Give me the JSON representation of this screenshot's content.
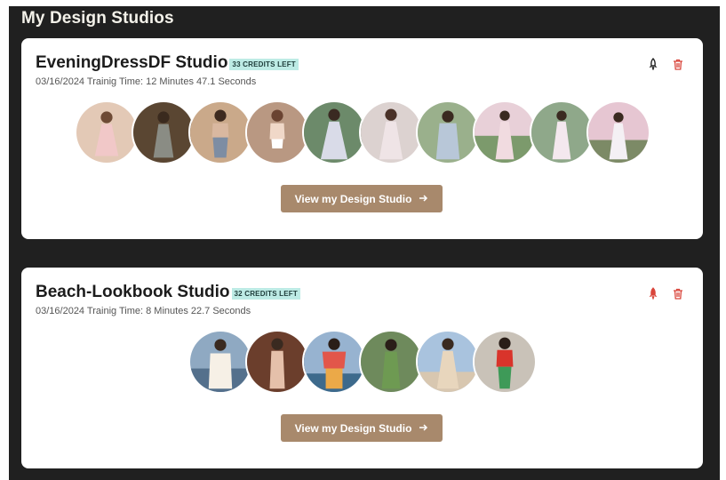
{
  "page_title": "My Design Studios",
  "colors": {
    "background": "#202020",
    "card": "#ffffff",
    "credits_badge": "#bdebe5",
    "button": "#a8896c",
    "delete_icon": "#d9453b",
    "status_icon_active": "#d9453b",
    "status_icon_inactive": "#222222"
  },
  "studios": [
    {
      "name": "EveningDressDF Studio",
      "credits": "33 CREDITS LEFT",
      "meta": "03/16/2024 Trainig Time: 12 Minutes 47.1 Seconds",
      "status_icon": "rocket-icon",
      "delete_icon": "trash-icon",
      "button_label": "View my Design Studio",
      "button_icon": "arrow-right-icon",
      "avatar_count": 10
    },
    {
      "name": "Beach-Lookbook Studio",
      "credits": "32 CREDITS LEFT",
      "meta": "03/16/2024 Trainig Time: 8 Minutes 22.7 Seconds",
      "status_icon": "rocket-icon",
      "delete_icon": "trash-icon",
      "button_label": "View my Design Studio",
      "button_icon": "arrow-right-icon",
      "avatar_count": 6
    }
  ]
}
